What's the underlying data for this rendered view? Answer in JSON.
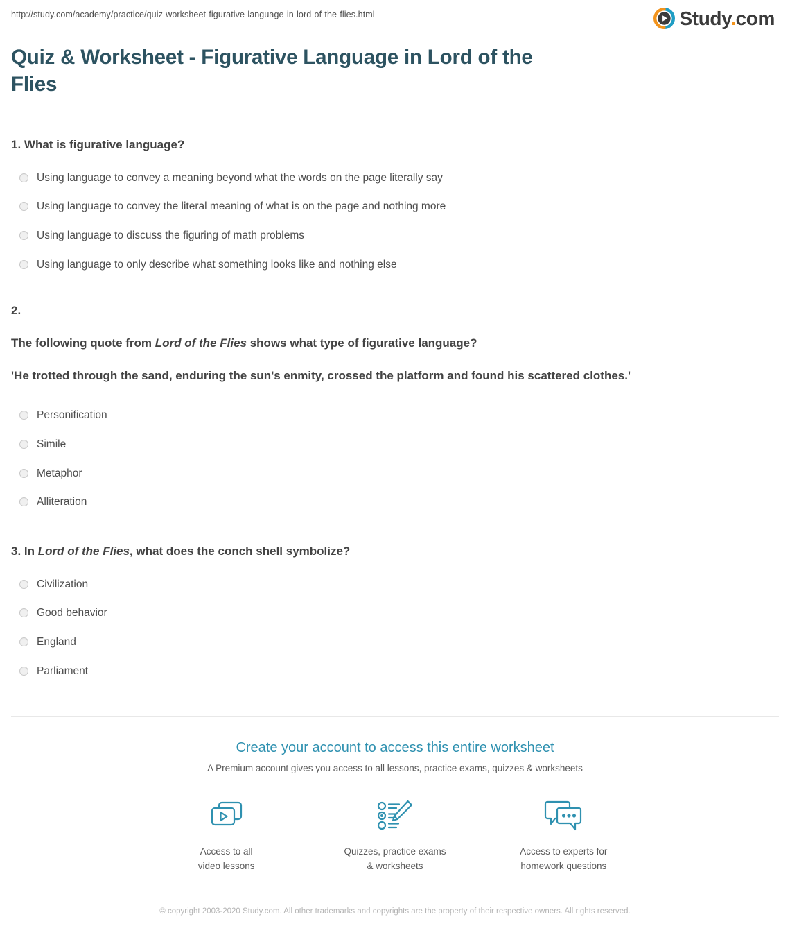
{
  "header": {
    "url": "http://study.com/academy/practice/quiz-worksheet-figurative-language-in-lord-of-the-flies.html",
    "logo_text_main": "Study",
    "logo_text_dot": ".",
    "logo_text_tld": "com",
    "logo_icon": "play-circle-icon",
    "logo_colors": {
      "ring_orange": "#f3941d",
      "ring_blue": "#1f9dc4",
      "play_triangle": "#3b3b3b",
      "dot_orange": "#f3941d"
    }
  },
  "title": "Quiz & Worksheet - Figurative Language in Lord of the Flies",
  "questions": [
    {
      "number": "1.",
      "prompt": "What is figurative language?",
      "prompt_prefix": "1. ",
      "options": [
        "Using language to convey a meaning beyond what the words on the page literally say",
        "Using language to convey the literal meaning of what is on the page and nothing more",
        "Using language to discuss the figuring of math problems",
        "Using language to only describe what something looks like and nothing else"
      ]
    },
    {
      "number": "2.",
      "sub_prompt_a": "The following quote from ",
      "sub_prompt_italic": "Lord of the Flies",
      "sub_prompt_b": " shows what type of figurative language?",
      "quote": "'He trotted through the sand, enduring the sun's enmity, crossed the platform and found his scattered clothes.'",
      "options": [
        "Personification",
        "Simile",
        "Metaphor",
        "Alliteration"
      ]
    },
    {
      "number": "3.",
      "prompt_prefix": "3. In ",
      "prompt_italic": "Lord of the Flies",
      "prompt_suffix": ", what does the conch shell symbolize?",
      "options": [
        "Civilization",
        "Good behavior",
        "England",
        "Parliament"
      ]
    }
  ],
  "footer": {
    "cta_link": "Create your account to access this entire worksheet",
    "cta_sub": "A Premium account gives you access to all lessons, practice exams, quizzes & worksheets",
    "features": [
      {
        "icon": "video-lessons-icon",
        "label": "Access to all\nvideo lessons"
      },
      {
        "icon": "quiz-checklist-pencil-icon",
        "label": "Quizzes, practice exams\n& worksheets"
      },
      {
        "icon": "chat-bubbles-icon",
        "label": "Access to experts for\nhomework questions"
      }
    ],
    "feature_icon_color": "#2f91b0",
    "copyright": "© copyright 2003-2020 Study.com. All other trademarks and copyrights are the property of their respective owners. All rights reserved."
  },
  "colors": {
    "title": "#2d5361",
    "cta": "#2f91b0",
    "body_text": "#4d4d4d",
    "divider": "#e8e8e8"
  }
}
